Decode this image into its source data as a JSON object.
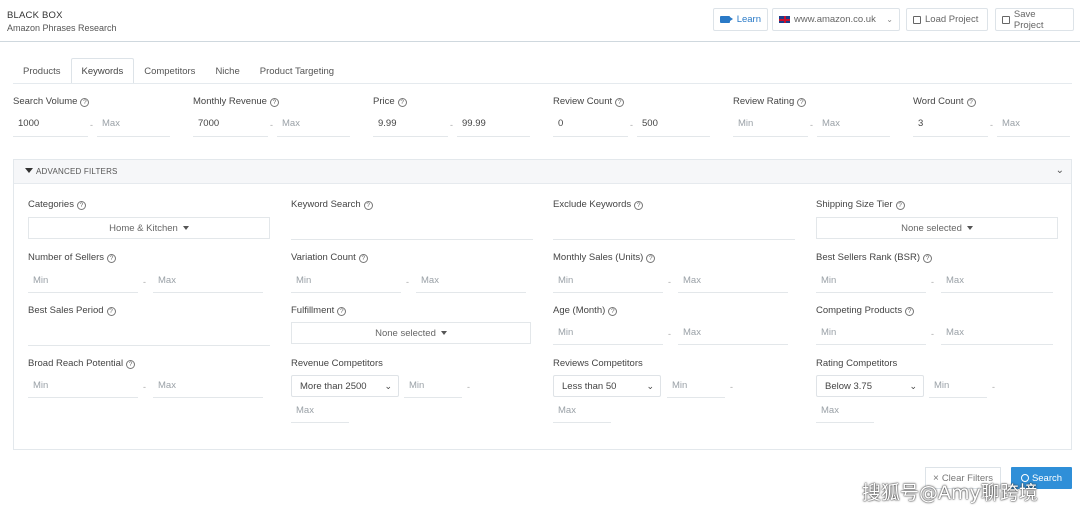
{
  "header": {
    "brand": "BLACK BOX",
    "subtitle": "Amazon Phrases Research",
    "learn_label": "Learn",
    "marketplace": "www.amazon.co.uk",
    "load_label": "Load Project",
    "save_label": "Save Project"
  },
  "tabs": [
    "Products",
    "Keywords",
    "Competitors",
    "Niche",
    "Product Targeting"
  ],
  "active_tab": "Keywords",
  "filters": {
    "search_volume": {
      "label": "Search Volume",
      "min": "1000",
      "max": "Max"
    },
    "monthly_revenue": {
      "label": "Monthly Revenue",
      "min": "7000",
      "max": "Max"
    },
    "price": {
      "label": "Price",
      "min": "9.99",
      "max": "99.99"
    },
    "review_count": {
      "label": "Review Count",
      "min": "0",
      "max": "500"
    },
    "review_rating": {
      "label": "Review Rating",
      "min": "Min",
      "max": "Max"
    },
    "word_count": {
      "label": "Word Count",
      "min": "3",
      "max": "Max"
    }
  },
  "advanced": {
    "title": "ADVANCED FILTERS",
    "categories": {
      "label": "Categories",
      "value": "Home & Kitchen"
    },
    "keyword_search": {
      "label": "Keyword Search"
    },
    "exclude_keywords": {
      "label": "Exclude Keywords"
    },
    "shipping_size_tier": {
      "label": "Shipping Size Tier",
      "value": "None selected"
    },
    "number_of_sellers": {
      "label": "Number of Sellers",
      "min": "Min",
      "max": "Max"
    },
    "variation_count": {
      "label": "Variation Count",
      "min": "Min",
      "max": "Max"
    },
    "monthly_sales_units": {
      "label": "Monthly Sales (Units)",
      "min": "Min",
      "max": "Max"
    },
    "best_sellers_rank": {
      "label": "Best Sellers Rank (BSR)",
      "min": "Min",
      "max": "Max"
    },
    "best_sales_period": {
      "label": "Best Sales Period"
    },
    "fulfillment": {
      "label": "Fulfillment",
      "value": "None selected"
    },
    "age_month": {
      "label": "Age (Month)",
      "min": "Min",
      "max": "Max"
    },
    "competing_products": {
      "label": "Competing Products",
      "min": "Min",
      "max": "Max"
    },
    "broad_reach_potential": {
      "label": "Broad Reach Potential",
      "min": "Min",
      "max": "Max"
    },
    "revenue_competitors": {
      "label": "Revenue Competitors",
      "select": "More than 2500",
      "min": "Min",
      "max": "Max"
    },
    "reviews_competitors": {
      "label": "Reviews Competitors",
      "select": "Less than 50",
      "min": "Min",
      "max": "Max"
    },
    "rating_competitors": {
      "label": "Rating Competitors",
      "select": "Below 3.75",
      "min": "Min",
      "max": "Max"
    }
  },
  "actions": {
    "clear_label": "Clear Filters",
    "search_label": "Search"
  },
  "watermark": "搜狐号@Amy聊跨境",
  "colors": {
    "accent": "#2f8fd8",
    "learn": "#2a7ac7"
  }
}
